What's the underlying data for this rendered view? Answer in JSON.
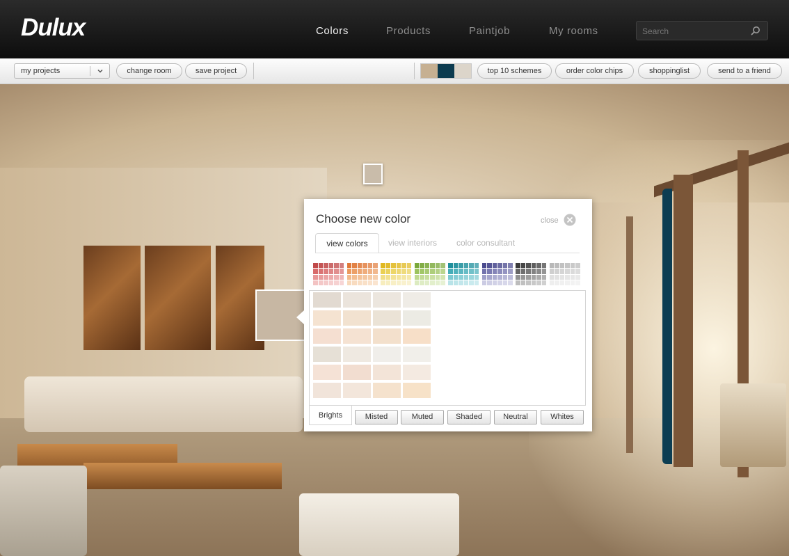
{
  "brand": {
    "logo": "Dulux"
  },
  "nav": {
    "items": [
      {
        "label": "Colors",
        "active": true
      },
      {
        "label": "Products",
        "active": false
      },
      {
        "label": "Paintjob",
        "active": false
      },
      {
        "label": "My rooms",
        "active": false
      }
    ]
  },
  "search": {
    "placeholder": "Search",
    "value": ""
  },
  "toolbar": {
    "projects_dropdown": "my projects",
    "change_room": "change room",
    "save_project": "save project",
    "current_scheme_colors": [
      "#c6b092",
      "#0c3b4f",
      "#dcd5ca"
    ],
    "top_schemes": "top 10 schemes",
    "order_chips": "order color chips",
    "shoppinglist": "shoppinglist",
    "send_friend": "send to a friend"
  },
  "scene": {
    "wall_marker_color": "#c9bcaa",
    "preview_color": "#c7b7a3",
    "accent_wall_color": "#0c3d52"
  },
  "dialog": {
    "title": "Choose new color",
    "close_label": "close",
    "tabs": [
      {
        "label": "view colors",
        "active": true
      },
      {
        "label": "view interiors",
        "active": false
      },
      {
        "label": "color consultant",
        "active": false
      }
    ],
    "families": [
      {
        "colors": [
          "#c04a4a",
          "#d86b6b",
          "#e89797",
          "#f3c3c3"
        ]
      },
      {
        "colors": [
          "#e07a3a",
          "#eb9a5e",
          "#f2ba8a",
          "#f8d9bb"
        ]
      },
      {
        "colors": [
          "#e0b820",
          "#ead053",
          "#f1df87",
          "#f7edbd"
        ]
      },
      {
        "colors": [
          "#7aa83a",
          "#9cc35e",
          "#bfd98f",
          "#dcebc0"
        ]
      },
      {
        "colors": [
          "#1f8f9c",
          "#44adb8",
          "#7cc9d1",
          "#b8e3e8"
        ]
      },
      {
        "colors": [
          "#4a4a8e",
          "#7373ad",
          "#a0a0c9",
          "#cbcbe3"
        ]
      },
      {
        "colors": [
          "#3a3a3a",
          "#666666",
          "#909090",
          "#bcbcbc"
        ]
      },
      {
        "colors": [
          "#b8b8b8",
          "#cfcfcf",
          "#e0e0e0",
          "#eeeeee"
        ]
      }
    ],
    "swatch_grid": [
      [
        "#e2dad1",
        "#ebe4dc",
        "#ece6de",
        "#efece6"
      ],
      [
        "#f5e3d1",
        "#f2e2d0",
        "#ebe3d6",
        "#ecebe4"
      ],
      [
        "#f5dfd1",
        "#f5e2d2",
        "#f3e0cc",
        "#f7dfc8"
      ],
      [
        "#e6e0d6",
        "#efe9e1",
        "#f0eeea",
        "#f1efea"
      ],
      [
        "#f5e2d6",
        "#f2ddd0",
        "#f3e4d8",
        "#f4eae1"
      ],
      [
        "#f1e4da",
        "#f3e6db",
        "#f5e2cd",
        "#f7e2c8"
      ]
    ],
    "categories": [
      {
        "label": "Brights",
        "active": true
      },
      {
        "label": "Misted",
        "active": false
      },
      {
        "label": "Muted",
        "active": false
      },
      {
        "label": "Shaded",
        "active": false
      },
      {
        "label": "Neutral",
        "active": false
      },
      {
        "label": "Whites",
        "active": false
      }
    ]
  }
}
